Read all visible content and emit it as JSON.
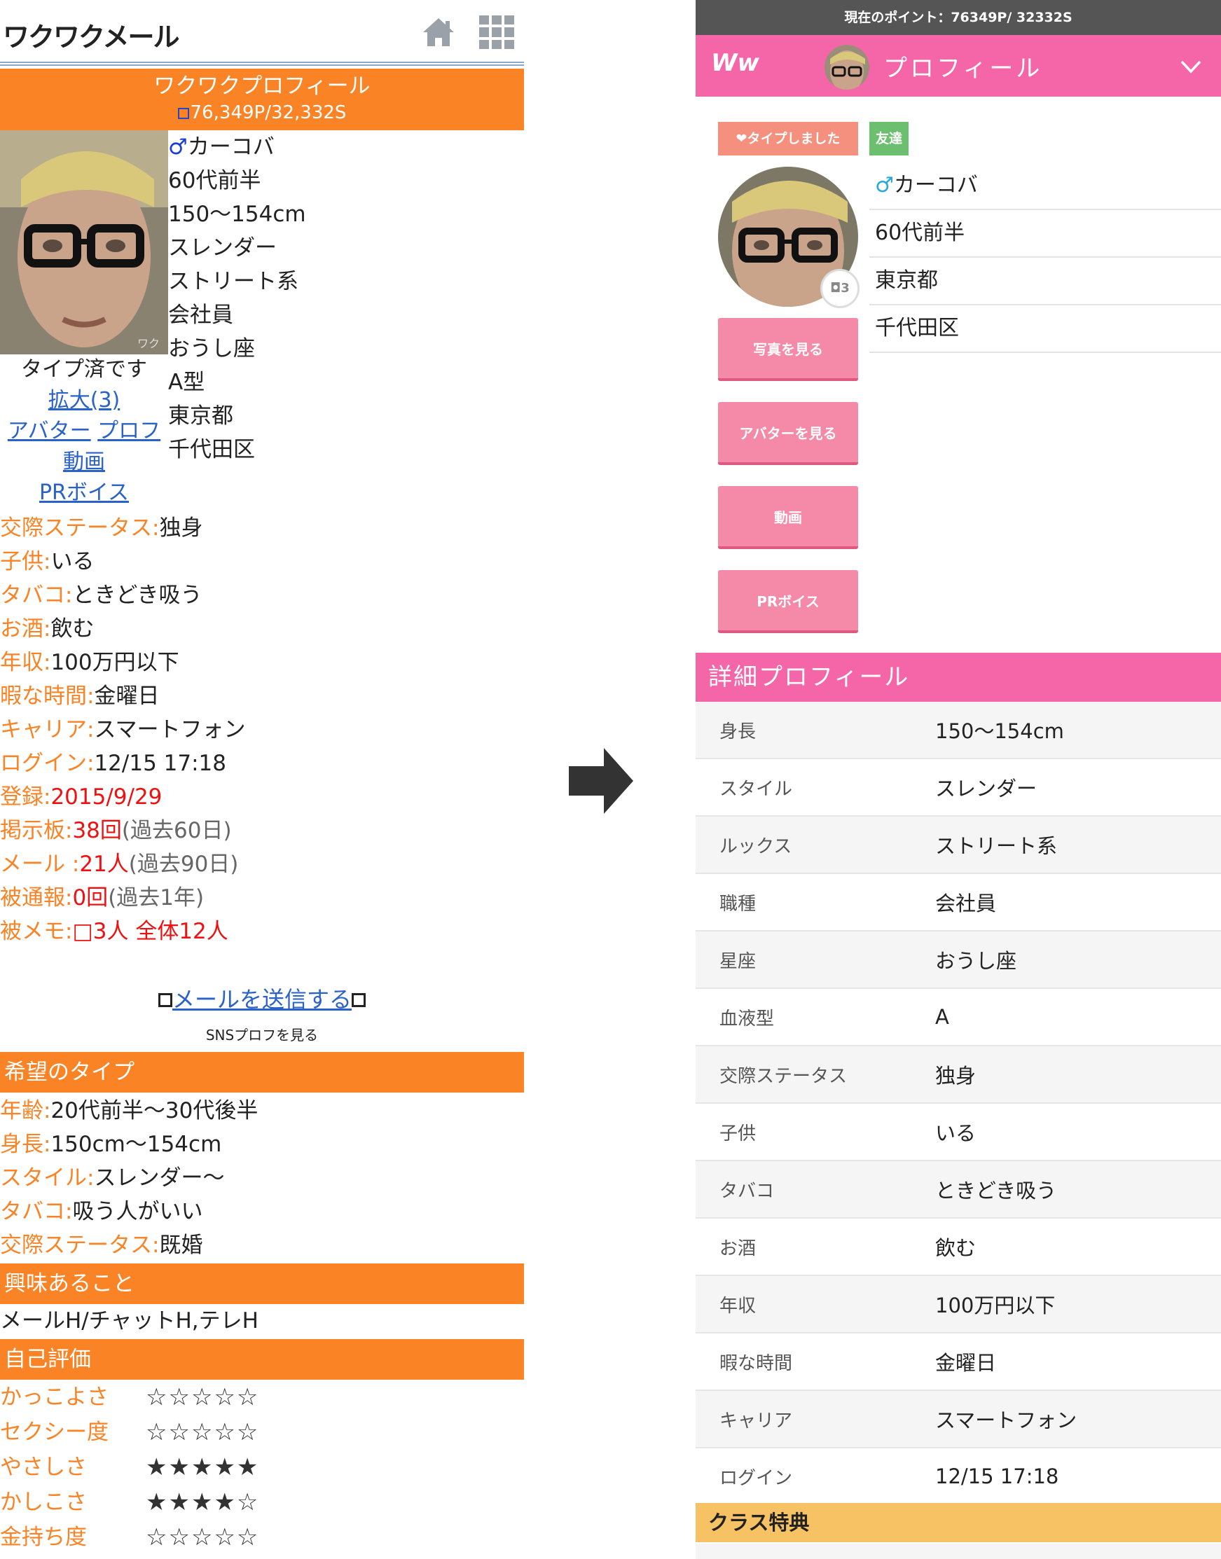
{
  "left": {
    "logo": "ワクワクメール",
    "banner_title": "ワクワクプロフィール",
    "banner_points": "76,349P/32,332S",
    "photo_side": {
      "typed": "タイプ済です",
      "zoom_link": "拡大(3)",
      "avatar_link": "アバター",
      "video_link": "プロフ動画",
      "pr_link": "PRボイス"
    },
    "basic": {
      "gender_symbol": "♂",
      "name": "カーコバ",
      "age": "60代前半",
      "height": "150〜154cm",
      "style": "スレンダー",
      "looks": "ストリート系",
      "job": "会社員",
      "star_sign": "おうし座",
      "blood": "A型",
      "prefecture": "東京都",
      "city": "千代田区"
    },
    "details": [
      {
        "k": "交際ステータス:",
        "v": "独身"
      },
      {
        "k": "子供:",
        "v": "いる"
      },
      {
        "k": "タバコ:",
        "v": "ときどき吸う"
      },
      {
        "k": "お酒:",
        "v": "飲む"
      },
      {
        "k": "年収:",
        "v": "100万円以下"
      },
      {
        "k": "暇な時間:",
        "v": "金曜日"
      },
      {
        "k": "キャリア:",
        "v": "スマートフォン"
      },
      {
        "k": "ログイン:",
        "v": "12/15 17:18"
      }
    ],
    "stats": {
      "register_k": "登録:",
      "register_v": "2015/9/29",
      "board_k": "掲示板:",
      "board_v": "38回",
      "board_note": "(過去60日)",
      "mail_k": "メール :",
      "mail_v": "21人",
      "mail_note": "(過去90日)",
      "report_k": "被通報:",
      "report_v": "0回",
      "report_note": "(過去1年)",
      "memo_k": "被メモ:",
      "memo_v": "3人 全体12人"
    },
    "send_mail": "メールを送信する",
    "sns_link": "SNSプロフを見る",
    "wish_title": "希望のタイプ",
    "wish": [
      {
        "k": "年齢:",
        "v": "20代前半〜30代後半"
      },
      {
        "k": "身長:",
        "v": "150cm〜154cm"
      },
      {
        "k": "スタイル:",
        "v": "スレンダー〜"
      },
      {
        "k": "タバコ:",
        "v": "吸う人がいい"
      },
      {
        "k": "交際ステータス:",
        "v": "既婚"
      }
    ],
    "interest_title": "興味あること",
    "interest": "メールH/チャットH,テレH",
    "self_title": "自己評価",
    "self": [
      {
        "k": "かっこよさ",
        "v": "☆☆☆☆☆"
      },
      {
        "k": "セクシー度",
        "v": "☆☆☆☆☆"
      },
      {
        "k": "やさしさ",
        "v": "★★★★★"
      },
      {
        "k": "かしこさ",
        "v": "★★★★☆"
      },
      {
        "k": "金持ち度",
        "v": "☆☆☆☆☆"
      }
    ]
  },
  "right": {
    "points_bar": "現在のポイント：76349P/ 32332S",
    "logo": "Ww",
    "title": "プロフィール",
    "badge_like": "❤タイプしました",
    "badge_friend": "友達",
    "photo_count": "3",
    "gender_symbol": "♂",
    "name": "カーコバ",
    "age": "60代前半",
    "prefecture": "東京都",
    "city": "千代田区",
    "buttons": [
      "写真を見る",
      "アバターを見る",
      "動画",
      "PRボイス"
    ],
    "detail_title": "詳細プロフィール",
    "detail": [
      {
        "k": "身長",
        "v": "150〜154cm"
      },
      {
        "k": "スタイル",
        "v": "スレンダー"
      },
      {
        "k": "ルックス",
        "v": "ストリート系"
      },
      {
        "k": "職種",
        "v": "会社員"
      },
      {
        "k": "星座",
        "v": "おうし座"
      },
      {
        "k": "血液型",
        "v": "A"
      },
      {
        "k": "交際ステータス",
        "v": "独身"
      },
      {
        "k": "子供",
        "v": "いる"
      },
      {
        "k": "タバコ",
        "v": "ときどき吸う"
      },
      {
        "k": "お酒",
        "v": "飲む"
      },
      {
        "k": "年収",
        "v": "100万円以下"
      },
      {
        "k": "暇な時間",
        "v": "金曜日"
      },
      {
        "k": "キャリア",
        "v": "スマートフォン"
      },
      {
        "k": "ログイン",
        "v": "12/15 17:18"
      }
    ],
    "class_title": "クラス特典"
  }
}
